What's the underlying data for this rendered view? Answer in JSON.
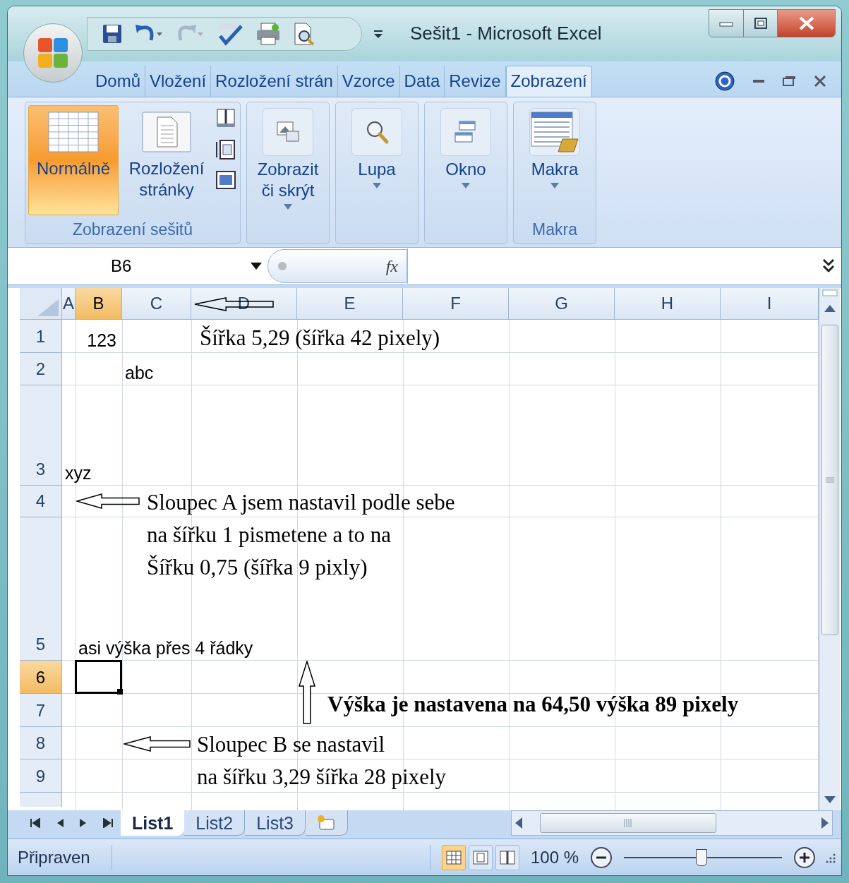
{
  "window": {
    "title": "Sešit1 - Microsoft Excel"
  },
  "ribbon_tabs": [
    {
      "label": "Domů",
      "selected": false
    },
    {
      "label": "Vložení",
      "selected": false
    },
    {
      "label": "Rozložení strán",
      "selected": false
    },
    {
      "label": "Vzorce",
      "selected": false
    },
    {
      "label": "Data",
      "selected": false
    },
    {
      "label": "Revize",
      "selected": false
    },
    {
      "label": "Zobrazení",
      "selected": true
    }
  ],
  "ribbon_groups": [
    {
      "label": "Zobrazení sešitů",
      "buttons": [
        {
          "kind": "view",
          "label": "Normálně",
          "selected": true
        },
        {
          "kind": "view",
          "label": "Rozložení stránky",
          "selected": false
        }
      ]
    },
    {
      "buttons": [
        {
          "kind": "menu",
          "label": "Zobrazit či skrýt"
        }
      ]
    },
    {
      "buttons": [
        {
          "kind": "menu",
          "label": "Lupa"
        }
      ]
    },
    {
      "buttons": [
        {
          "kind": "menu",
          "label": "Okno"
        }
      ]
    },
    {
      "label": "Makra",
      "buttons": [
        {
          "kind": "menu",
          "label": "Makra"
        }
      ]
    }
  ],
  "name_box": {
    "value": "B6"
  },
  "formula_bar": {
    "function_label": "fx"
  },
  "columns": [
    {
      "label": "A",
      "selected": false
    },
    {
      "label": "B",
      "selected": true
    },
    {
      "label": "C",
      "selected": false
    },
    {
      "label": "D",
      "selected": false
    },
    {
      "label": "E",
      "selected": false
    },
    {
      "label": "F",
      "selected": false
    },
    {
      "label": "G",
      "selected": false
    },
    {
      "label": "H",
      "selected": false
    },
    {
      "label": "I",
      "selected": false
    }
  ],
  "rows": [
    {
      "label": "1",
      "selected": false
    },
    {
      "label": "2",
      "selected": false
    },
    {
      "label": "3",
      "selected": false
    },
    {
      "label": "4",
      "selected": false
    },
    {
      "label": "5",
      "selected": false
    },
    {
      "label": "6",
      "selected": true
    },
    {
      "label": "7",
      "selected": false
    },
    {
      "label": "8",
      "selected": false
    },
    {
      "label": "9",
      "selected": false
    }
  ],
  "cells": [
    {
      "text": "123"
    },
    {
      "text": "abc"
    },
    {
      "text": "xyz"
    },
    {
      "text": "asi výška přes 4 řádky"
    }
  ],
  "text_boxes": [
    {
      "lines": [
        "Šířka 5,29 (šířka 42 pixely)"
      ],
      "bold": false
    },
    {
      "lines": [
        "Sloupec A jsem nastavil podle sebe",
        "na šířku 1 pismetene a to na",
        "Šířku 0,75 (šířka 9 pixly)"
      ],
      "bold": false
    },
    {
      "lines": [
        "Výška je nastavena na 64,50 výška 89 pixely"
      ],
      "bold": true
    },
    {
      "lines": [
        "Sloupec B se nastavil",
        "na šířku 3,29 šířka 28 pixely"
      ],
      "bold": false
    }
  ],
  "sheet_tabs": [
    {
      "label": "List1",
      "selected": true
    },
    {
      "label": "List2",
      "selected": false
    },
    {
      "label": "List3",
      "selected": false
    }
  ],
  "status_bar": {
    "status": "Připraven",
    "view_buttons": [
      {
        "selected": true
      },
      {
        "selected": false
      },
      {
        "selected": false
      }
    ],
    "zoom": "100 %",
    "zoom_slider": {
      "level": 0.49
    }
  }
}
